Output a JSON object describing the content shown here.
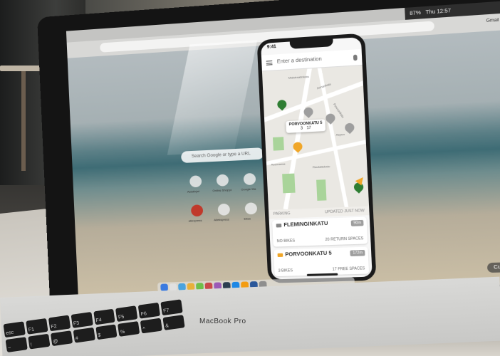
{
  "browser": {
    "search_placeholder": "Search Google or type a URL",
    "menubar_time": "Thu 12:57",
    "menubar_battery": "87%",
    "shortcuts": [
      "Asiakirjat",
      "Online Shoppi",
      "Google Ma",
      "aliexpress",
      "Aliekspress",
      "Elisa"
    ],
    "top_right_link": "Gmail",
    "customize_label": "Customize"
  },
  "phone": {
    "status_time": "9:41",
    "search_placeholder": "Enter a destination",
    "streets": [
      "Maistraatinkatu",
      "Annankatu",
      "Fleminginkatu",
      "Porvoonkatu",
      "Rautatiekatu",
      "Vallila",
      "Sörnäisten"
    ],
    "map_label_station": "Asemanse",
    "map_label_aspen": "Aspen",
    "callout": {
      "title": "PORVOONKATU 5",
      "bikes": "3",
      "spaces": "17"
    },
    "list_header_left": "PARKING",
    "list_header_right": "UPDATED JUST NOW",
    "cards": [
      {
        "title": "FLEMINGINKATU",
        "distance": "90m",
        "left": "NO BIKES",
        "right": "20 RETURN SPACES"
      },
      {
        "title": "PORVOONKATU 5",
        "distance": "172m",
        "left": "3 BIKES",
        "right": "17 FREE SPACES"
      }
    ]
  },
  "laptop": {
    "brand": "MacBook Pro"
  },
  "keyboard": {
    "keys": [
      "esc",
      "F1",
      "F2",
      "F3",
      "F4",
      "F5",
      "F6",
      "F7",
      "~",
      "!",
      "@",
      "#",
      "$",
      "%",
      "^",
      "&"
    ]
  },
  "colors": {
    "accent_green": "#2e7d32",
    "accent_orange": "#f0a628"
  }
}
